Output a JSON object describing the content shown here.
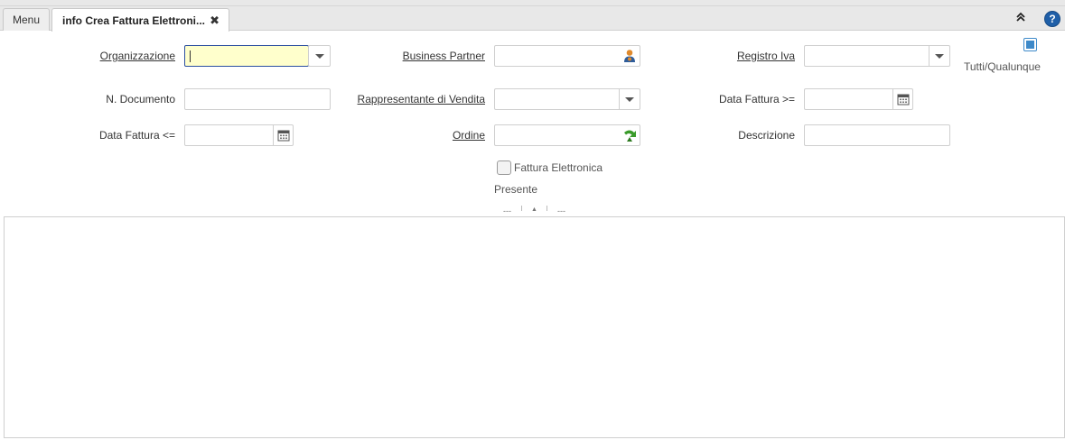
{
  "tabs": {
    "menu_label": "Menu",
    "active_label": "info Crea Fattura Elettroni...",
    "close_glyph": "✖"
  },
  "toolbar": {
    "help_glyph": "?"
  },
  "form": {
    "organizzazione": {
      "label": "Organizzazione",
      "value": ""
    },
    "business_partner": {
      "label": "Business Partner",
      "value": ""
    },
    "registro_iva": {
      "label": "Registro Iva",
      "value": ""
    },
    "tutti_qualunque": {
      "label": "Tutti/Qualunque",
      "checked": true
    },
    "n_documento": {
      "label": "N. Documento",
      "value": ""
    },
    "rappresentante": {
      "label": "Rappresentante di Vendita",
      "value": ""
    },
    "data_fattura_da": {
      "label": "Data Fattura >=",
      "value": ""
    },
    "data_fattura_a": {
      "label": "Data Fattura <=",
      "value": ""
    },
    "ordine": {
      "label": "Ordine",
      "value": ""
    },
    "descrizione": {
      "label": "Descrizione",
      "value": ""
    },
    "fattura_elettronica": {
      "label": "Fattura Elettronica",
      "checked": false
    },
    "presente": {
      "label": "Presente"
    }
  },
  "splitter": {
    "left_glyph": "---",
    "mid_glyph": "▲",
    "right_glyph": "---"
  },
  "colors": {
    "focus_bg": "#ffffcc",
    "focus_border": "#2b4fa0",
    "accent_blue": "#3d89c9",
    "help_blue": "#1f5fa8"
  },
  "icons": {
    "business_partner": "person-icon",
    "ordine": "green-arrow-icon",
    "dates": "calendar-icon",
    "dropdowns": "chevron-down-icon"
  }
}
